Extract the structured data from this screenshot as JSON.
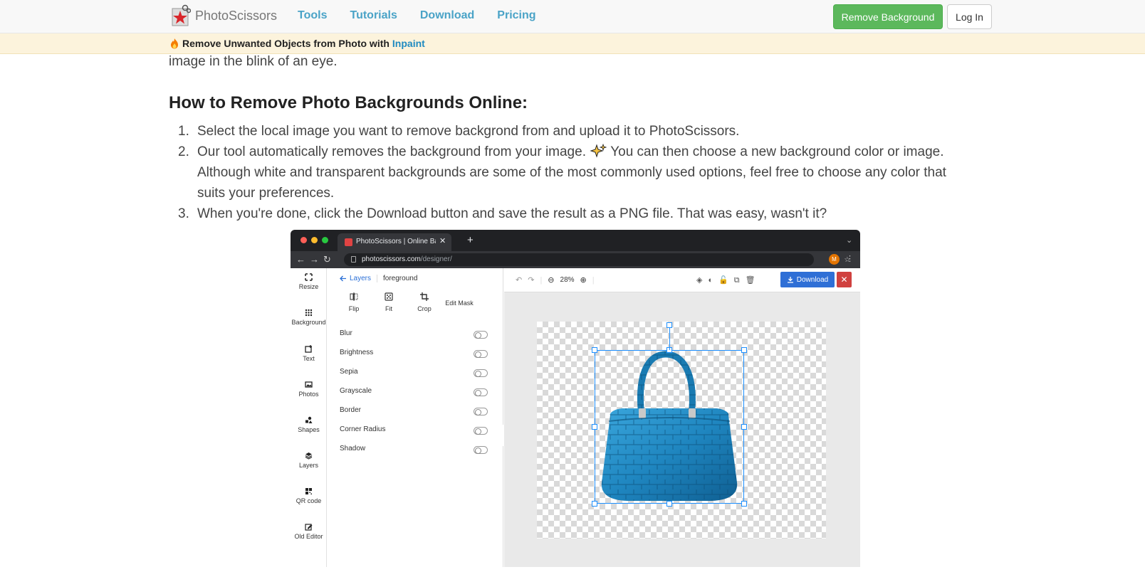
{
  "nav": {
    "brand": "PhotoScissors",
    "links": [
      "Tools",
      "Tutorials",
      "Download",
      "Pricing"
    ],
    "remove_bg_label": "Remove Background",
    "login_label": "Log In"
  },
  "promo": {
    "text": "Remove Unwanted Objects from Photo with",
    "link": "Inpaint"
  },
  "article": {
    "cut_line": "image in the blink of an eye.",
    "heading": "How to Remove Photo Backgrounds Online:",
    "steps": [
      {
        "num": "1.",
        "text": "Select the local image you want to remove backgrond from and upload it to PhotoScissors."
      },
      {
        "num": "2.",
        "text_a": "Our tool automatically removes the background from your image.",
        "text_b": "You can then choose a new background color or image. Although white and transparent backgrounds are some of the most commonly used options, feel free to choose any color that suits your preferences."
      },
      {
        "num": "3.",
        "text": "When you're done, click the Download button and save the result as a PNG file. That was easy, wasn't it?"
      }
    ]
  },
  "screenshot": {
    "tab_title": "PhotoScissors | Online Backgr",
    "url_host": "photoscissors.com",
    "url_path": "/designer/",
    "avatar_letter": "M",
    "rail": [
      "Resize",
      "Background",
      "Text",
      "Photos",
      "Shapes",
      "Layers",
      "QR code",
      "Old Editor"
    ],
    "panel": {
      "back_label": "Layers",
      "layer_name": "foreground",
      "tools": [
        "Flip",
        "Fit",
        "Crop",
        "Edit Mask"
      ],
      "adjustments": [
        "Blur",
        "Brightness",
        "Sepia",
        "Grayscale",
        "Border",
        "Corner Radius",
        "Shadow"
      ]
    },
    "workspace": {
      "zoom": "28%",
      "download_label": "Download"
    }
  },
  "colors": {
    "nav_link": "#4aa3c7",
    "remove_bg": "#5cb85c",
    "promo_bg": "#fcf3dc",
    "download_btn": "#2f6fd6",
    "close_btn": "#d0413f",
    "bag": "#1f86c0"
  }
}
